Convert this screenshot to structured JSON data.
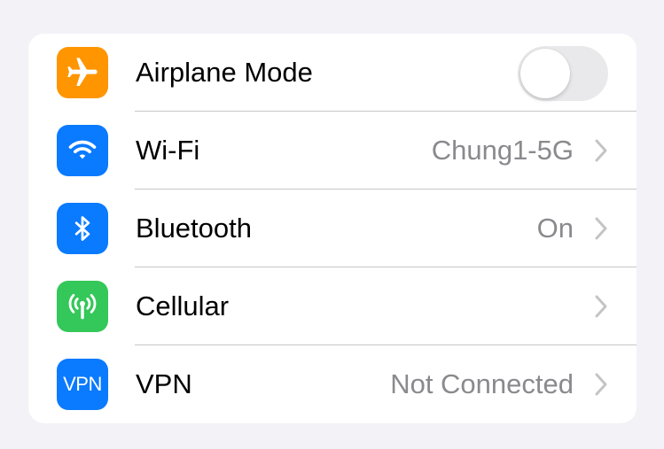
{
  "colors": {
    "page_background": "#f2f2f7",
    "card_background": "#ffffff",
    "airplane_orange": "#ff9500",
    "system_blue": "#0a7aff",
    "cellular_green": "#34c759",
    "secondary_text": "#8a8a8e",
    "toggle_off": "#e9e9eb"
  },
  "settings": {
    "rows": [
      {
        "label": "Airplane Mode",
        "icon": "airplane-icon",
        "control": "toggle",
        "toggle_on": false
      },
      {
        "label": "Wi-Fi",
        "icon": "wifi-icon",
        "value": "Chung1-5G",
        "control": "chevron"
      },
      {
        "label": "Bluetooth",
        "icon": "bluetooth-icon",
        "value": "On",
        "control": "chevron"
      },
      {
        "label": "Cellular",
        "icon": "cellular-antenna-icon",
        "value": "",
        "control": "chevron"
      },
      {
        "label": "VPN",
        "icon": "vpn-icon",
        "icon_text": "VPN",
        "value": "Not Connected",
        "control": "chevron"
      }
    ]
  }
}
